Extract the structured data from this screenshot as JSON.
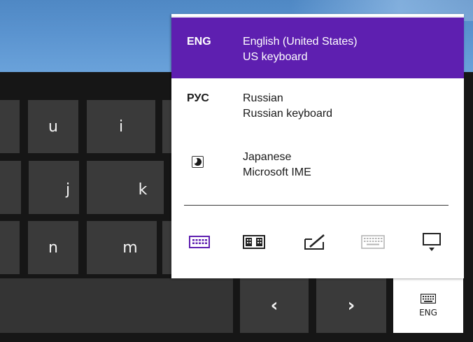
{
  "keyboard": {
    "keys": {
      "u": "u",
      "i": "i",
      "j": "j",
      "k": "k",
      "n": "n",
      "m": "m"
    },
    "prev_arrow": "‹",
    "next_arrow": "›",
    "lang_key_label": "ENG"
  },
  "language_menu": {
    "items": [
      {
        "code": "ENG",
        "language": "English (United States)",
        "keyboard": "US keyboard",
        "selected": true
      },
      {
        "code": "РУС",
        "language": "Russian",
        "keyboard": "Russian keyboard",
        "selected": false
      },
      {
        "code": "",
        "icon": "japanese-ime-icon",
        "language": "Japanese",
        "keyboard": "Microsoft IME",
        "selected": false
      }
    ],
    "layout_options": [
      {
        "name": "standard-keyboard-icon",
        "active": true
      },
      {
        "name": "split-keyboard-icon",
        "active": false
      },
      {
        "name": "handwriting-icon",
        "active": false
      },
      {
        "name": "full-keyboard-icon",
        "active": false,
        "disabled": true
      },
      {
        "name": "dock-keyboard-icon",
        "active": false
      }
    ]
  },
  "colors": {
    "accent": "#5e1fb0",
    "key_bg": "#3a3a3a",
    "keyboard_bg": "#161616",
    "flyout_bg": "#ffffff",
    "disabled_icon": "#b5b5b5"
  }
}
